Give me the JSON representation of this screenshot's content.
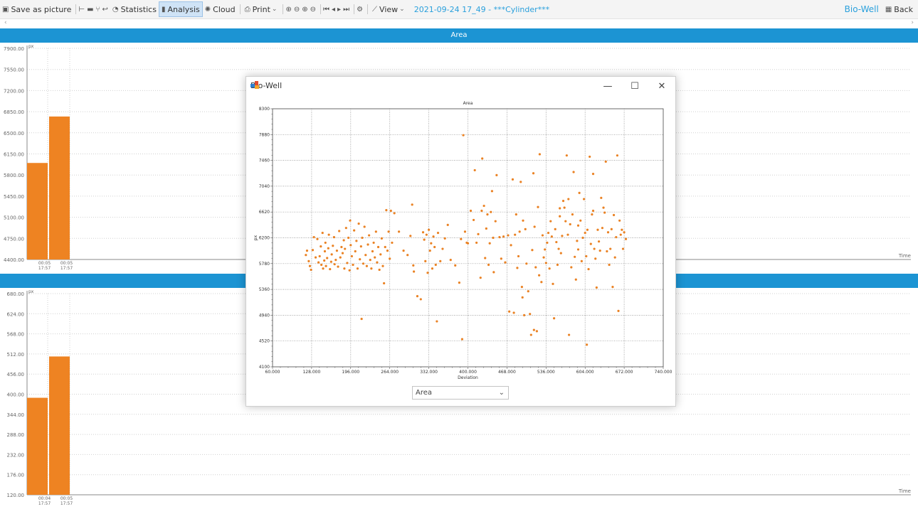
{
  "toolbar": {
    "save_picture": "Save as picture",
    "statistics": "Statistics",
    "analysis": "Analysis",
    "cloud": "Cloud",
    "print": "Print",
    "view": "View",
    "session_title": "2021-09-24 17_49 - ***Cylinder***",
    "brand": "Bio-Well",
    "back": "Back"
  },
  "band_top": {
    "title": "Area"
  },
  "band_mid": {
    "title": ""
  },
  "top_chart": {
    "y_unit": "px",
    "x_unit": "Time",
    "y_ticks": [
      "7900.00",
      "7550.00",
      "7200.00",
      "6850.00",
      "6500.00",
      "6150.00",
      "5800.00",
      "5450.00",
      "5100.00",
      "4750.00",
      "4400.00"
    ],
    "x_labels": [
      [
        "00:05",
        "17:57"
      ],
      [
        "00:05",
        "17:57"
      ]
    ],
    "bar_values": [
      6000,
      6770
    ],
    "y_min": 4400,
    "y_max": 7900
  },
  "bottom_chart": {
    "y_unit": "px",
    "x_unit": "Time",
    "y_ticks": [
      "680.00",
      "624.00",
      "568.00",
      "512.00",
      "456.00",
      "400.00",
      "344.00",
      "288.00",
      "232.00",
      "176.00",
      "120.00"
    ],
    "x_labels": [
      [
        "00:04",
        "17:57"
      ],
      [
        "00:05",
        "17:57"
      ]
    ],
    "bar_values": [
      390,
      505
    ],
    "y_min": 120,
    "y_max": 680
  },
  "modal": {
    "title": "Bio-Well",
    "select_value": "Area",
    "controls": [
      "minimize",
      "maximize",
      "close"
    ]
  },
  "colors": {
    "accent": "#1c94d3",
    "bar": "#ee8322",
    "point": "#ea8224"
  },
  "chart_data": {
    "type": "scatter",
    "title": "Area",
    "xlabel": "Deviation",
    "ylabel": "px",
    "xlim": [
      60,
      740
    ],
    "ylim": [
      4100,
      8300
    ],
    "x_ticks": [
      "60.000",
      "128.000",
      "196.000",
      "264.000",
      "332.000",
      "400.000",
      "468.000",
      "536.000",
      "604.000",
      "672.000",
      "740.000"
    ],
    "y_ticks": [
      "4100",
      "4520",
      "4940",
      "5360",
      "5780",
      "6200",
      "6620",
      "7040",
      "7460",
      "7880",
      "8300"
    ],
    "grid": true,
    "series": [
      {
        "points": [
          [
            118,
            5920
          ],
          [
            120,
            5990
          ],
          [
            123,
            5820
          ],
          [
            125,
            5740
          ],
          [
            127,
            5680
          ],
          [
            130,
            6000
          ],
          [
            132,
            6210
          ],
          [
            135,
            5880
          ],
          [
            138,
            6180
          ],
          [
            140,
            5800
          ],
          [
            142,
            5900
          ],
          [
            144,
            6060
          ],
          [
            145,
            5760
          ],
          [
            147,
            6280
          ],
          [
            148,
            5700
          ],
          [
            150,
            5830
          ],
          [
            151,
            5980
          ],
          [
            152,
            6120
          ],
          [
            153,
            5740
          ],
          [
            155,
            5870
          ],
          [
            157,
            6030
          ],
          [
            158,
            6250
          ],
          [
            160,
            5690
          ],
          [
            162,
            5810
          ],
          [
            163,
            5930
          ],
          [
            165,
            6070
          ],
          [
            167,
            6210
          ],
          [
            168,
            5770
          ],
          [
            170,
            5840
          ],
          [
            172,
            5990
          ],
          [
            174,
            5730
          ],
          [
            176,
            6310
          ],
          [
            178,
            5880
          ],
          [
            180,
            6050
          ],
          [
            182,
            5950
          ],
          [
            184,
            6160
          ],
          [
            185,
            5700
          ],
          [
            186,
            6020
          ],
          [
            188,
            6360
          ],
          [
            190,
            5790
          ],
          [
            192,
            6200
          ],
          [
            194,
            5670
          ],
          [
            195,
            6480
          ],
          [
            196,
            6080
          ],
          [
            198,
            5900
          ],
          [
            200,
            5760
          ],
          [
            202,
            6320
          ],
          [
            204,
            5980
          ],
          [
            206,
            6150
          ],
          [
            208,
            5700
          ],
          [
            210,
            6430
          ],
          [
            212,
            5850
          ],
          [
            214,
            6060
          ],
          [
            215,
            4880
          ],
          [
            216,
            6200
          ],
          [
            218,
            5780
          ],
          [
            220,
            6380
          ],
          [
            222,
            5920
          ],
          [
            224,
            5740
          ],
          [
            226,
            6090
          ],
          [
            228,
            6240
          ],
          [
            230,
            5840
          ],
          [
            232,
            5700
          ],
          [
            234,
            5980
          ],
          [
            236,
            6120
          ],
          [
            238,
            5880
          ],
          [
            240,
            6300
          ],
          [
            242,
            5800
          ],
          [
            244,
            6050
          ],
          [
            246,
            5680
          ],
          [
            248,
            5930
          ],
          [
            250,
            6190
          ],
          [
            252,
            5740
          ],
          [
            254,
            5460
          ],
          [
            256,
            6050
          ],
          [
            258,
            6650
          ],
          [
            260,
            5990
          ],
          [
            262,
            6300
          ],
          [
            264,
            5860
          ],
          [
            266,
            6640
          ],
          [
            268,
            6120
          ],
          [
            272,
            6600
          ],
          [
            280,
            6300
          ],
          [
            288,
            5990
          ],
          [
            295,
            5920
          ],
          [
            300,
            6230
          ],
          [
            303,
            6740
          ],
          [
            305,
            5750
          ],
          [
            306,
            5650
          ],
          [
            312,
            5250
          ],
          [
            318,
            5200
          ],
          [
            322,
            6290
          ],
          [
            324,
            6170
          ],
          [
            326,
            5820
          ],
          [
            328,
            6250
          ],
          [
            330,
            5630
          ],
          [
            332,
            6330
          ],
          [
            334,
            5990
          ],
          [
            336,
            6110
          ],
          [
            338,
            5700
          ],
          [
            340,
            6220
          ],
          [
            342,
            6050
          ],
          [
            344,
            5760
          ],
          [
            346,
            4840
          ],
          [
            348,
            6280
          ],
          [
            352,
            5820
          ],
          [
            356,
            6020
          ],
          [
            360,
            6190
          ],
          [
            365,
            6410
          ],
          [
            370,
            5840
          ],
          [
            378,
            5750
          ],
          [
            385,
            5470
          ],
          [
            388,
            6180
          ],
          [
            390,
            4550
          ],
          [
            392,
            7870
          ],
          [
            395,
            6300
          ],
          [
            398,
            6120
          ],
          [
            400,
            6110
          ],
          [
            405,
            6640
          ],
          [
            410,
            6490
          ],
          [
            412,
            7300
          ],
          [
            415,
            6120
          ],
          [
            418,
            6260
          ],
          [
            422,
            5550
          ],
          [
            424,
            6640
          ],
          [
            425,
            7490
          ],
          [
            428,
            6720
          ],
          [
            430,
            5870
          ],
          [
            432,
            6350
          ],
          [
            434,
            6580
          ],
          [
            436,
            5760
          ],
          [
            438,
            6110
          ],
          [
            440,
            6620
          ],
          [
            442,
            6960
          ],
          [
            444,
            6200
          ],
          [
            445,
            5640
          ],
          [
            448,
            6470
          ],
          [
            450,
            7220
          ],
          [
            455,
            6210
          ],
          [
            458,
            5860
          ],
          [
            462,
            6220
          ],
          [
            465,
            5800
          ],
          [
            470,
            6240
          ],
          [
            472,
            5000
          ],
          [
            475,
            6080
          ],
          [
            478,
            7150
          ],
          [
            480,
            4980
          ],
          [
            482,
            6250
          ],
          [
            484,
            6580
          ],
          [
            486,
            5710
          ],
          [
            488,
            5900
          ],
          [
            490,
            6300
          ],
          [
            492,
            7110
          ],
          [
            494,
            5400
          ],
          [
            495,
            5230
          ],
          [
            496,
            6480
          ],
          [
            498,
            4940
          ],
          [
            500,
            6340
          ],
          [
            502,
            5780
          ],
          [
            505,
            5330
          ],
          [
            508,
            4960
          ],
          [
            510,
            4620
          ],
          [
            512,
            6000
          ],
          [
            514,
            7250
          ],
          [
            515,
            4700
          ],
          [
            516,
            6380
          ],
          [
            518,
            5720
          ],
          [
            520,
            4680
          ],
          [
            522,
            6700
          ],
          [
            524,
            5590
          ],
          [
            525,
            7560
          ],
          [
            528,
            5480
          ],
          [
            530,
            6240
          ],
          [
            532,
            5880
          ],
          [
            534,
            6010
          ],
          [
            536,
            5790
          ],
          [
            538,
            6120
          ],
          [
            540,
            6280
          ],
          [
            542,
            5700
          ],
          [
            544,
            6470
          ],
          [
            546,
            6220
          ],
          [
            548,
            5450
          ],
          [
            550,
            4890
          ],
          [
            552,
            6340
          ],
          [
            554,
            6130
          ],
          [
            556,
            5760
          ],
          [
            558,
            6020
          ],
          [
            560,
            6550
          ],
          [
            562,
            5950
          ],
          [
            564,
            6230
          ],
          [
            566,
            6800
          ],
          [
            568,
            6690
          ],
          [
            570,
            6470
          ],
          [
            572,
            7540
          ],
          [
            574,
            6250
          ],
          [
            575,
            6830
          ],
          [
            576,
            4620
          ],
          [
            578,
            6420
          ],
          [
            580,
            5720
          ],
          [
            582,
            6580
          ],
          [
            584,
            7270
          ],
          [
            586,
            5890
          ],
          [
            588,
            5520
          ],
          [
            590,
            6150
          ],
          [
            592,
            6010
          ],
          [
            594,
            6930
          ],
          [
            596,
            6480
          ],
          [
            598,
            5820
          ],
          [
            600,
            6200
          ],
          [
            602,
            6830
          ],
          [
            604,
            6280
          ],
          [
            606,
            5900
          ],
          [
            607,
            4460
          ],
          [
            608,
            6330
          ],
          [
            610,
            5690
          ],
          [
            612,
            7520
          ],
          [
            614,
            6100
          ],
          [
            616,
            6580
          ],
          [
            618,
            7240
          ],
          [
            620,
            6020
          ],
          [
            622,
            5860
          ],
          [
            624,
            5390
          ],
          [
            626,
            6330
          ],
          [
            628,
            6140
          ],
          [
            630,
            5990
          ],
          [
            632,
            6850
          ],
          [
            634,
            6360
          ],
          [
            636,
            6690
          ],
          [
            638,
            6610
          ],
          [
            640,
            7440
          ],
          [
            642,
            5980
          ],
          [
            644,
            6290
          ],
          [
            646,
            5760
          ],
          [
            648,
            6020
          ],
          [
            650,
            6340
          ],
          [
            652,
            5400
          ],
          [
            654,
            6570
          ],
          [
            656,
            5880
          ],
          [
            658,
            6210
          ],
          [
            660,
            7540
          ],
          [
            662,
            5010
          ],
          [
            664,
            6480
          ],
          [
            666,
            6250
          ],
          [
            668,
            6330
          ],
          [
            670,
            6020
          ],
          [
            672,
            6290
          ],
          [
            675,
            6180
          ],
          [
            560,
            6680
          ],
          [
            592,
            6400
          ],
          [
            618,
            6640
          ]
        ]
      }
    ]
  }
}
